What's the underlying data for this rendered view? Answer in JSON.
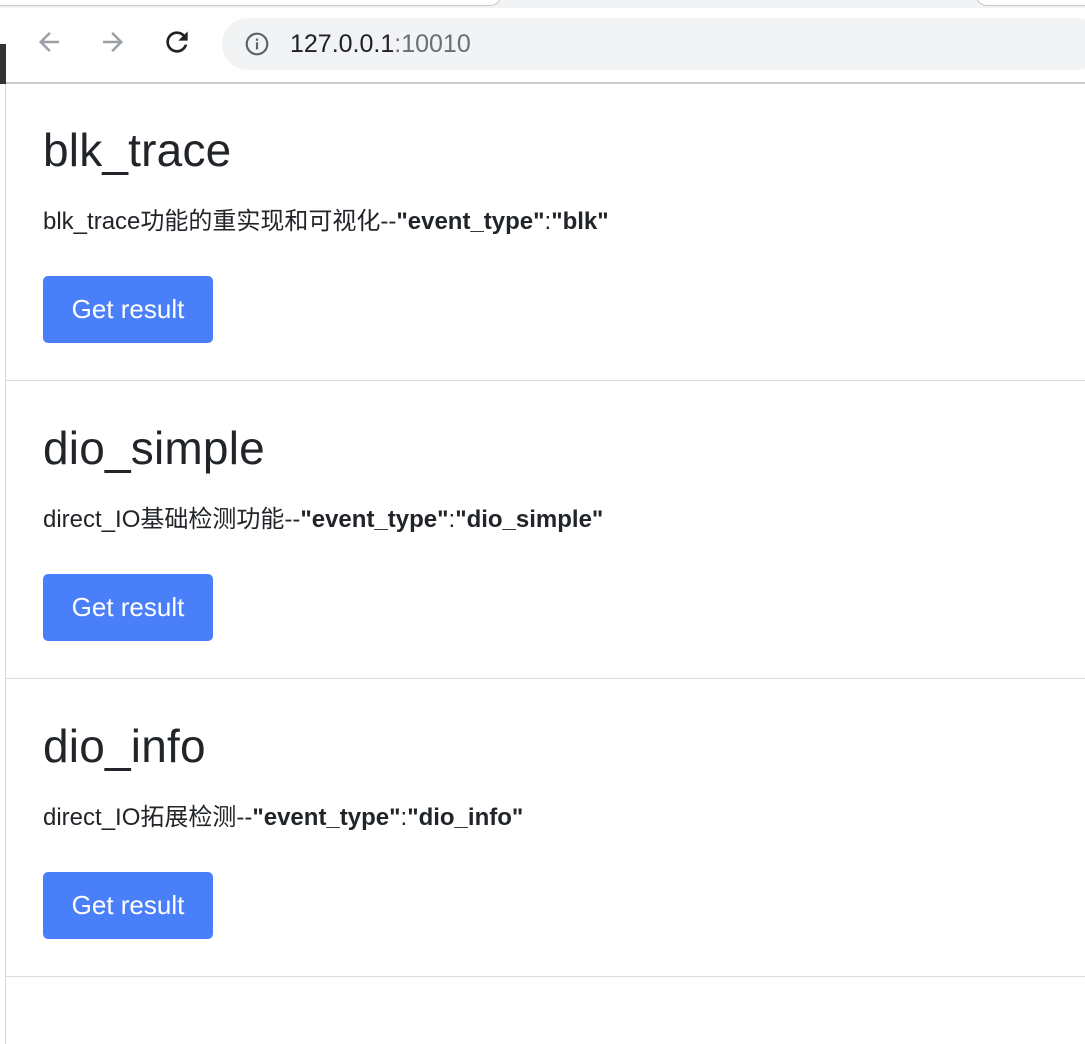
{
  "browser": {
    "url_host": "127.0.0.1",
    "url_port": ":10010",
    "icons": {
      "back": "back-arrow-icon",
      "forward": "forward-arrow-icon",
      "reload": "reload-icon",
      "site_info": "info-icon"
    }
  },
  "cards": [
    {
      "title": "blk_trace",
      "desc_text": "blk_trace功能的重实现和可视化--",
      "desc_key": "\"event_type\"",
      "desc_sep": ":",
      "desc_value": "\"blk\"",
      "button_label": "Get result"
    },
    {
      "title": "dio_simple",
      "desc_text": "direct_IO基础检测功能--",
      "desc_key": "\"event_type\"",
      "desc_sep": ":",
      "desc_value": "\"dio_simple\"",
      "button_label": "Get result"
    },
    {
      "title": "dio_info",
      "desc_text": "direct_IO拓展检测--",
      "desc_key": "\"event_type\"",
      "desc_sep": ":",
      "desc_value": "\"dio_info\"",
      "button_label": "Get result"
    }
  ],
  "colors": {
    "button_bg": "#4a7ffa",
    "text": "#212529"
  }
}
